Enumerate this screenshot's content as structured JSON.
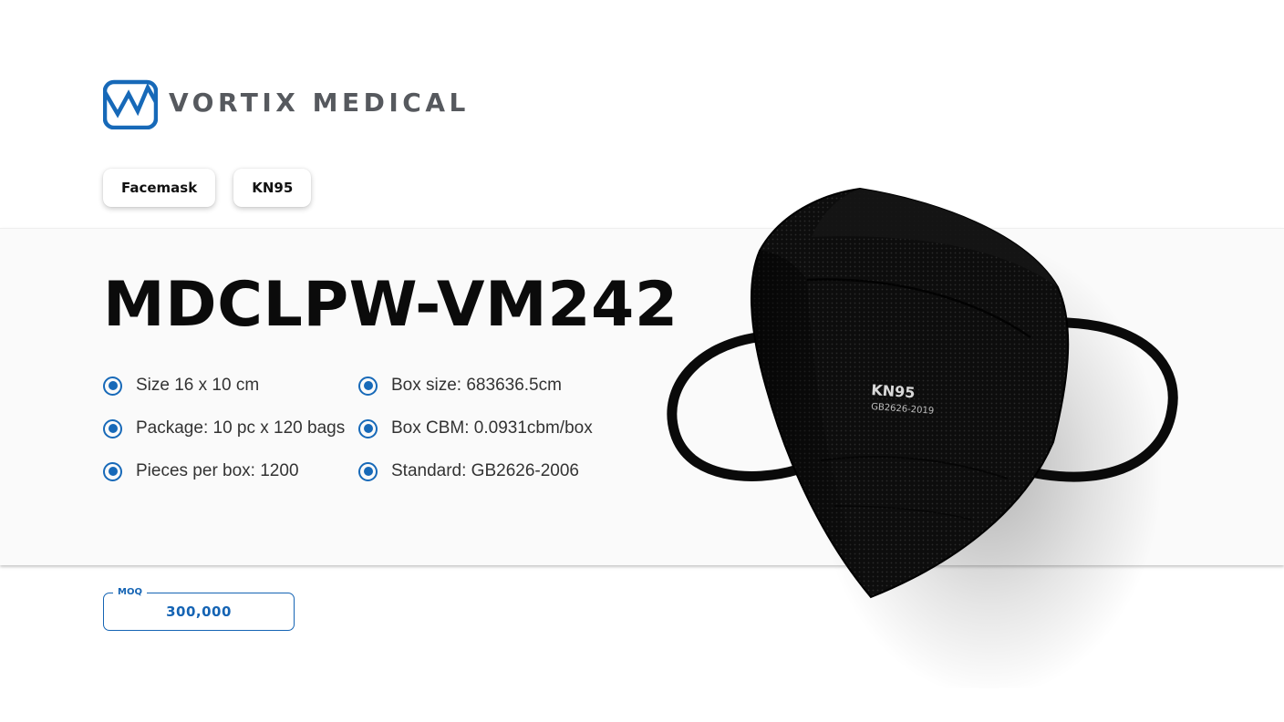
{
  "brand": {
    "name": "VORTIX MEDICAL",
    "logo_icon": "vortix-logo-icon",
    "primary_color": "#1769b8",
    "text_color": "#56595e"
  },
  "tags": [
    {
      "label": "Facemask"
    },
    {
      "label": "KN95"
    }
  ],
  "product": {
    "model": "MDCLPW-VM242",
    "image_icon": "kn95-mask-image",
    "mask_print_title": "KN95",
    "mask_print_code": "GB2626-2019"
  },
  "specs": {
    "left": [
      "Size 16 x 10 cm",
      "Package: 10 pc x 120 bags",
      "Pieces per box: 1200"
    ],
    "right": [
      "Box size: 683636.5cm",
      "Box CBM: 0.0931cbm/box",
      "Standard: GB2626-2006"
    ]
  },
  "moq": {
    "label": "MOQ",
    "value": "300,000"
  }
}
